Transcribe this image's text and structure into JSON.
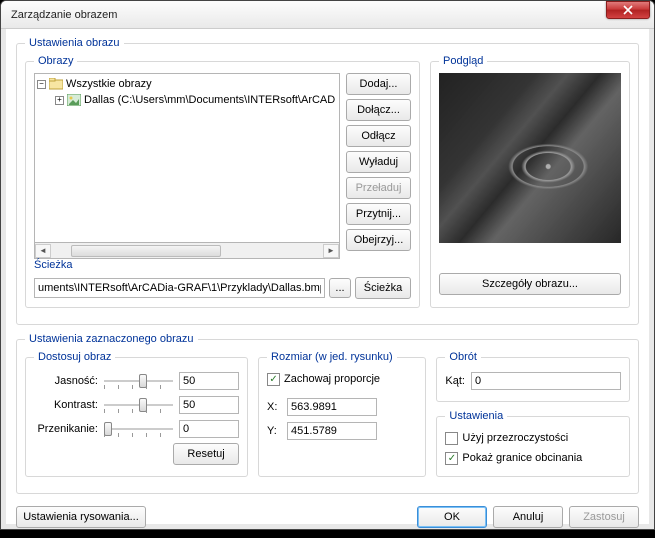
{
  "title": "Zarządzanie obrazem",
  "groups": {
    "ustawienia_obrazu": "Ustawienia obrazu",
    "obrazy": "Obrazy",
    "podglad": "Podgląd",
    "sciezka": "Ścieżka",
    "ustawienia_zaznaczonego": "Ustawienia zaznaczonego obrazu",
    "dostosuj": "Dostosuj obraz",
    "rozmiar": "Rozmiar (w jed. rysunku)",
    "obrot": "Obrót",
    "ustawienia": "Ustawienia"
  },
  "tree": {
    "root": "Wszystkie obrazy",
    "child": "Dallas  (C:\\Users\\mm\\Documents\\INTERsoft\\ArCAD"
  },
  "buttons": {
    "dodaj": "Dodaj...",
    "dolacz": "Dołącz...",
    "odlacz": "Odłącz",
    "wyladuj": "Wyładuj",
    "przeladuj": "Przeładuj",
    "przytnij": "Przytnij...",
    "obejrzyj": "Obejrzyj...",
    "browse": "...",
    "sciezka": "Ścieżka",
    "szczegoly": "Szczegóły obrazu...",
    "resetuj": "Resetuj",
    "ust_rysowania": "Ustawienia rysowania...",
    "ok": "OK",
    "anuluj": "Anuluj",
    "zastosuj": "Zastosuj"
  },
  "path_value": "uments\\INTERsoft\\ArCADia-GRAF\\1\\Przyklady\\Dallas.bmp",
  "adjust": {
    "jasnosc_label": "Jasność:",
    "kontrast_label": "Kontrast:",
    "przenikanie_label": "Przenikanie:",
    "jasnosc": "50",
    "kontrast": "50",
    "przenikanie": "0"
  },
  "size": {
    "proporcje": "Zachowaj proporcje",
    "x_label": "X:",
    "y_label": "Y:",
    "x": "563.9891",
    "y": "451.5789"
  },
  "rotation": {
    "kat_label": "Kąt:",
    "kat": "0"
  },
  "settings": {
    "przezroczystosc": "Użyj przezroczystości",
    "granice": "Pokaż granice obcinania"
  },
  "checks": {
    "proporcje": true,
    "przezroczystosc": false,
    "granice": true
  }
}
